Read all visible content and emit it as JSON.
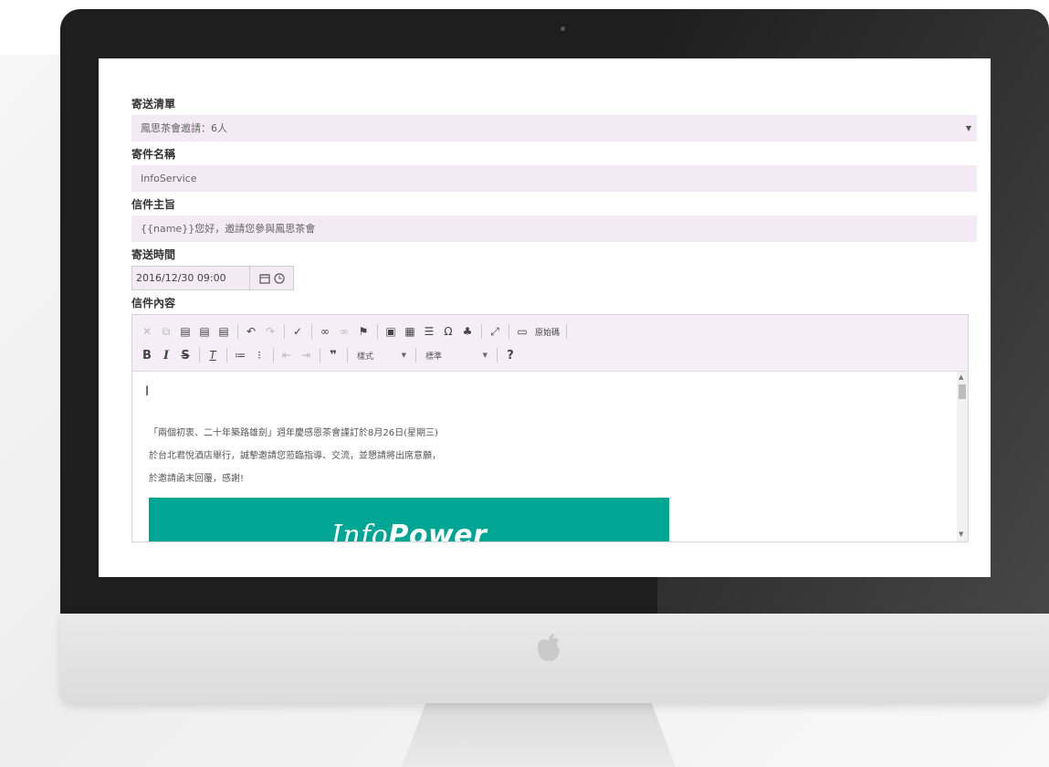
{
  "form": {
    "recipients_label": "寄送清單",
    "recipients_value": "鳳思茶會邀請：6人",
    "sender_label": "寄件名稱",
    "sender_value": "InfoService",
    "subject_label": "信件主旨",
    "subject_value": "{{name}}您好，邀請您參與鳳思茶會",
    "send_time_label": "寄送時間",
    "send_time_value": "2016/12/30 09:00",
    "content_label": "信件內容"
  },
  "toolbar": {
    "source_label": "原始碼",
    "format_label": "樣式",
    "size_label": "標準",
    "help_label": "?"
  },
  "editor": {
    "cursor": "I",
    "line1": "「兩個初衷、二十年築路雄劍」週年慶感恩茶會謹訂於8月26日(星期三)",
    "line2": "於台北君悅酒店舉行，誠摯邀請您蒞臨指導、交流，並懇請將出席意願，",
    "line3": "於邀請函末回覆，感謝!",
    "banner_info": "Info",
    "banner_power": "Power"
  },
  "colors": {
    "field_bg": "#f3eaf3",
    "banner": "#00a694",
    "bezel": "#1e1e1e"
  }
}
